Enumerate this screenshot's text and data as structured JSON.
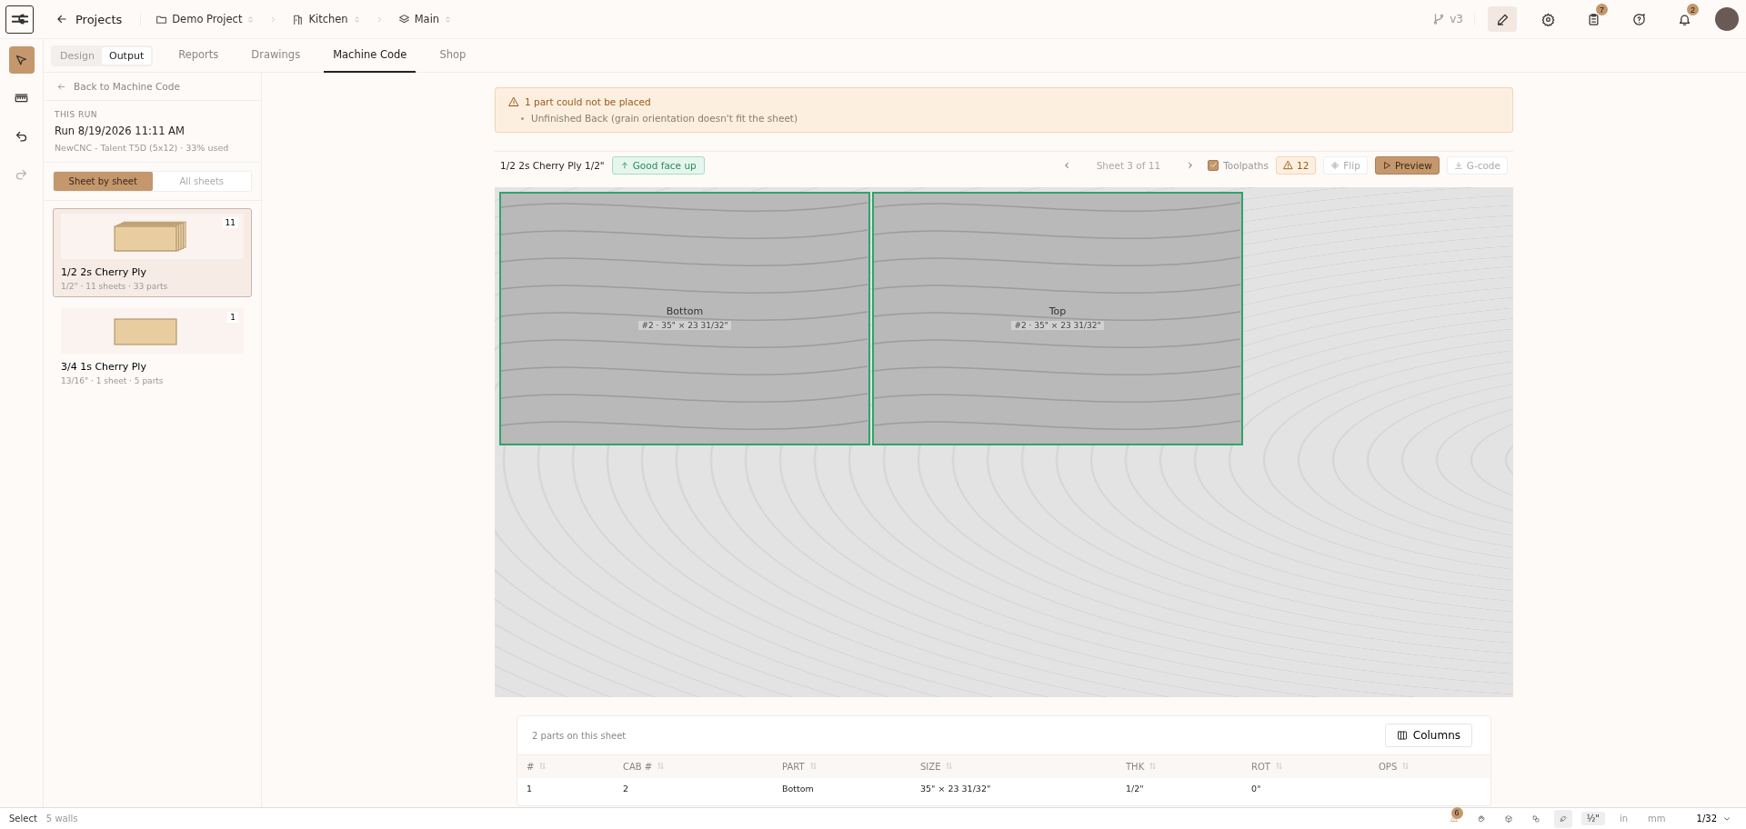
{
  "top_bar": {
    "back_label": "Projects",
    "breadcrumbs": [
      {
        "label": "Demo Project",
        "kind": "folder"
      },
      {
        "label": "Kitchen",
        "kind": "room"
      },
      {
        "label": "Main",
        "kind": "layers"
      }
    ],
    "version": "v3",
    "actions": [
      {
        "kind": "pencil",
        "selected": true
      },
      {
        "kind": "gear",
        "selected": false
      },
      {
        "kind": "checklist",
        "selected": false,
        "badge": "7"
      },
      {
        "kind": "help",
        "selected": false
      },
      {
        "kind": "bell",
        "selected": false,
        "badge": "2"
      }
    ]
  },
  "mode_toggle": [
    {
      "label": "Design",
      "selected": false
    },
    {
      "label": "Output",
      "selected": true
    }
  ],
  "tabs": [
    {
      "label": "Reports",
      "selected": false
    },
    {
      "label": "Drawings",
      "selected": false
    },
    {
      "label": "Machine Code",
      "selected": true
    },
    {
      "label": "Shop",
      "selected": false
    }
  ],
  "rail_tools": [
    {
      "kind": "pointer",
      "selected": true,
      "disabled": false
    },
    {
      "kind": "ruler",
      "selected": false,
      "disabled": false
    },
    {
      "kind": "undo",
      "selected": false,
      "disabled": false
    },
    {
      "kind": "redo",
      "selected": false,
      "disabled": true
    }
  ],
  "sidebar": {
    "back_link": "Back to Machine Code",
    "section_label": "THIS RUN",
    "run_title": "Run 8/19/2026 11:11 AM",
    "run_detail": "NewCNC - Talent T5D (5x12) · 33% used",
    "view_toggle": [
      {
        "label": "Sheet by sheet",
        "selected": true
      },
      {
        "label": "All sheets",
        "selected": false
      }
    ],
    "materials": [
      {
        "name": "1/2 2s Cherry Ply",
        "detail": "1/2\" · 11 sheets · 33 parts",
        "count": "11",
        "stacked": true,
        "selected": true
      },
      {
        "name": "3/4 1s Cherry Ply",
        "detail": "13/16\" · 1 sheet · 5 parts",
        "count": "1",
        "stacked": false,
        "selected": false
      }
    ]
  },
  "warning": {
    "title": "1 part could not be placed",
    "items": [
      "Unfinished Back (grain orientation doesn't fit the sheet)"
    ]
  },
  "sheet_toolbar": {
    "material": "1/2 2s Cherry Ply 1/2\"",
    "face_badge": "Good face up",
    "pager": "Sheet 3 of 11",
    "toolpaths": {
      "label": "Toolpaths",
      "checked": true
    },
    "warning_count": "12",
    "buttons": [
      {
        "label": "Flip",
        "kind": "flip",
        "primary": false
      },
      {
        "label": "Preview",
        "kind": "play",
        "primary": true
      },
      {
        "label": "G-code",
        "kind": "download",
        "primary": false
      }
    ]
  },
  "sheet": {
    "parts": [
      {
        "name": "Bottom",
        "detail": "#2 · 35\" × 23 31/32\""
      },
      {
        "name": "Top",
        "detail": "#2 · 35\" × 23 31/32\""
      }
    ]
  },
  "parts_table": {
    "summary": "2 parts on this sheet",
    "columns_button": "Columns",
    "columns": [
      "#",
      "CAB #",
      "PART",
      "SIZE",
      "THK",
      "ROT",
      "OPS"
    ],
    "rows": [
      {
        "cells": [
          "1",
          "2",
          "Bottom",
          "35\" × 23 31/32\"",
          "1/2\"",
          "0°"
        ]
      }
    ]
  },
  "status_bar": {
    "mode": "Select",
    "detail": "5 walls",
    "warning_badge": "6",
    "tools": [
      {
        "kind": "palette",
        "selected": false
      },
      {
        "kind": "cube",
        "selected": false
      },
      {
        "kind": "link",
        "selected": false
      },
      {
        "kind": "brush",
        "selected": true
      }
    ],
    "units": [
      {
        "label": "½\"",
        "selected": true
      },
      {
        "label": "in",
        "selected": false
      },
      {
        "label": "mm",
        "selected": false
      }
    ],
    "precision": "1/32"
  }
}
